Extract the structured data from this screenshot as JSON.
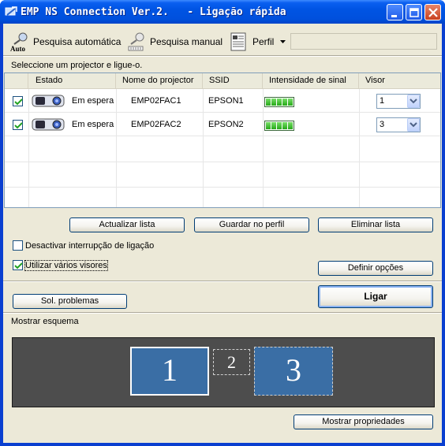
{
  "window": {
    "title": "EMP NS Connection Ver.2.   - Ligação rápida",
    "icon": "emp-connection-icon"
  },
  "toolbar": {
    "auto_search": {
      "label": "Pesquisa automática",
      "icon": "auto-search-icon",
      "icon_text": "Auto"
    },
    "manual_search": {
      "label": "Pesquisa manual",
      "icon": "manual-search-icon"
    },
    "profile": {
      "label": "Perfil",
      "icon": "profile-icon",
      "value": ""
    }
  },
  "hint": "Seleccione um projector e ligue-o.",
  "list": {
    "columns": [
      "Estado",
      "Nome do projector",
      "SSID",
      "Intensidade de sinal",
      "Visor"
    ],
    "rows": [
      {
        "checked": true,
        "status": "Em espera",
        "name": "EMP02FAC1",
        "ssid": "EPSON1",
        "signal_bars": 5,
        "display": "1"
      },
      {
        "checked": true,
        "status": "Em espera",
        "name": "EMP02FAC2",
        "ssid": "EPSON2",
        "signal_bars": 5,
        "display": "3"
      }
    ]
  },
  "buttons": {
    "refresh": "Actualizar lista",
    "save_profile": "Guardar no perfil",
    "delete_list": "Eliminar lista",
    "set_options": "Definir opções",
    "troubleshoot": "Sol. problemas",
    "connect": "Ligar",
    "show_properties": "Mostrar propriedades"
  },
  "options": {
    "disable_interrupt": {
      "label": "Desactivar interrupção de ligação",
      "checked": false
    },
    "multi_display": {
      "label": "Utilizar vários visores",
      "checked": true
    }
  },
  "schema": {
    "label": "Mostrar esquema",
    "displays": [
      {
        "number": "1",
        "selected": true
      },
      {
        "number": "2",
        "selected": false
      },
      {
        "number": "3",
        "selected": false
      }
    ]
  },
  "colors": {
    "titlebar": "#0054e3",
    "face": "#ece9d8",
    "display_fill": "#3a6ea5",
    "schema_bg": "#4d4d4d",
    "signal": "#26a818"
  }
}
